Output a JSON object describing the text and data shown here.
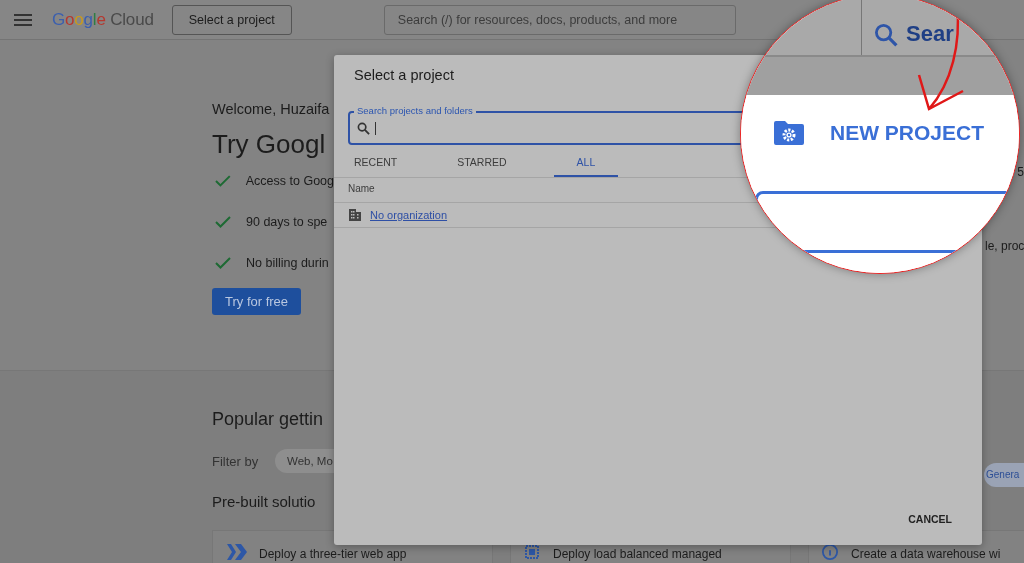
{
  "top_bar": {
    "logo": "Google Cloud",
    "project_button": "Select a project",
    "search": {
      "placeholder": "Search (/) for resources, docs, products, and more"
    }
  },
  "welcome": {
    "greeting": "Welcome, Huzaifa",
    "heading": "Try Googl",
    "benefits": [
      "Access to Goog",
      "90 days to spe",
      "No billing durin"
    ],
    "button": "Try for free"
  },
  "getting_started": {
    "heading": "Popular gettin",
    "filter_label": "Filter by",
    "filter_chip": "Web, Mo",
    "subheading": "Pre-built solutio",
    "cards": [
      "Deploy a three-tier web app",
      "Deploy load balanced managed",
      "Create a data warehouse wi"
    ]
  },
  "right_edge": {
    "texts": [
      "5",
      "le, proc"
    ],
    "chip": "Genera"
  },
  "dialog": {
    "title": "Select a project",
    "search": {
      "label": "Search projects and folders"
    },
    "tabs": [
      {
        "label": "RECENT",
        "selected": false
      },
      {
        "label": "STARRED",
        "selected": false
      },
      {
        "label": "ALL",
        "selected": true
      }
    ],
    "columns": [
      "Name"
    ],
    "rows": [
      {
        "name": "No organization"
      }
    ],
    "cancel_button": "CANCEL"
  },
  "magnifier": {
    "search_button": "Sear",
    "new_project_button": "NEW PROJECT"
  }
}
